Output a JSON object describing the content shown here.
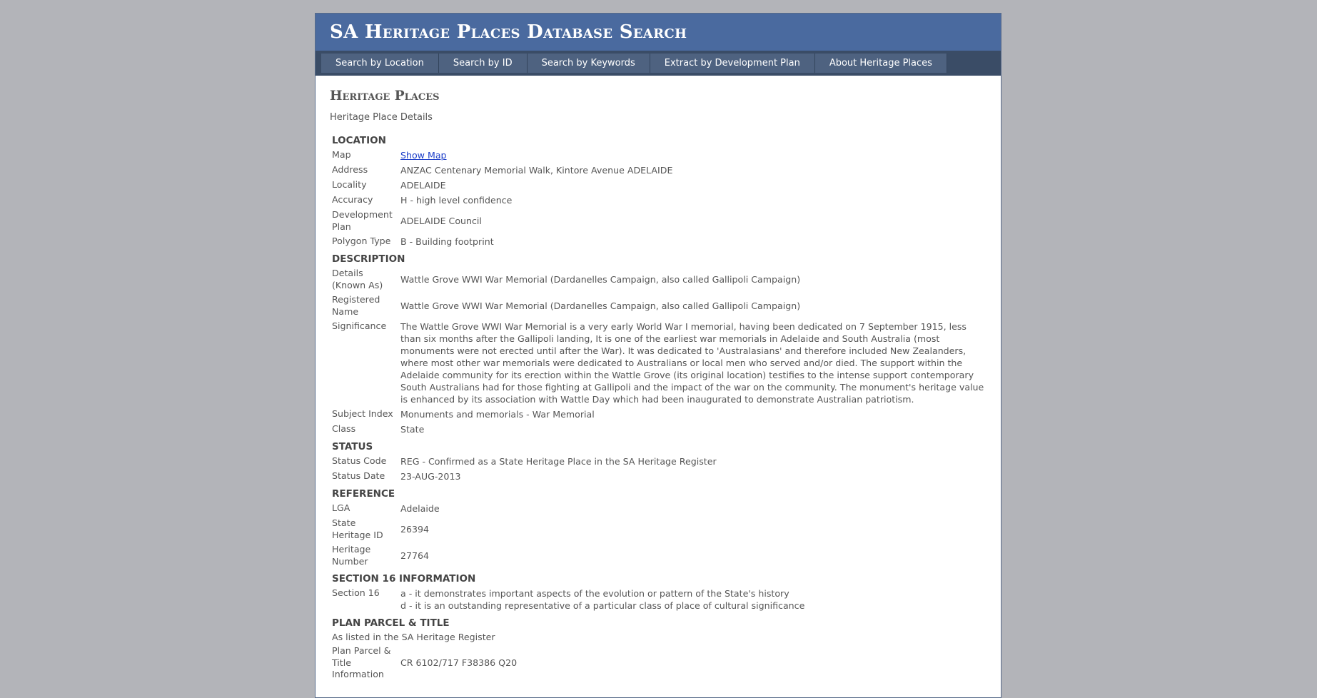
{
  "header": {
    "title": "SA Heritage Places Database Search"
  },
  "nav": [
    {
      "label": "Search by Location"
    },
    {
      "label": "Search by ID"
    },
    {
      "label": "Search by Keywords"
    },
    {
      "label": "Extract by Development Plan"
    },
    {
      "label": "About Heritage Places"
    }
  ],
  "page": {
    "heading": "Heritage Places",
    "subtitle": "Heritage Place Details"
  },
  "location": {
    "title": "LOCATION",
    "map_label": "Map",
    "map_link": "Show Map",
    "address_label": "Address",
    "address": "ANZAC Centenary Memorial Walk, Kintore Avenue ADELAIDE",
    "locality_label": "Locality",
    "locality": "ADELAIDE",
    "accuracy_label": "Accuracy",
    "accuracy": "H - high level confidence",
    "devplan_label": "Development Plan",
    "devplan": "ADELAIDE Council",
    "polygon_label": "Polygon Type",
    "polygon": "B - Building footprint"
  },
  "description": {
    "title": "DESCRIPTION",
    "known_as_label": "Details (Known As)",
    "known_as": "Wattle Grove WWI War Memorial (Dardanelles Campaign, also called Gallipoli Campaign)",
    "registered_label": "Registered Name",
    "registered": "Wattle Grove WWI War Memorial (Dardanelles Campaign, also called Gallipoli Campaign)",
    "significance_label": "Significance",
    "significance": "The Wattle Grove WWI War Memorial is a very early World War I memorial, having been dedicated on 7 September 1915, less than six months after the Gallipoli landing, It is one of the earliest war memorials in Adelaide and South Australia (most monuments were not erected until after the War). It was dedicated to 'Australasians' and therefore included New Zealanders, where most other war memorials were dedicated to Australians or local men who served and/or died. The support within the Adelaide community for its erection within the Wattle Grove (its original location) testifies to the intense support contemporary South Australians had for those fighting at Gallipoli and the impact of the war on the community. The monument's heritage value is enhanced by its association with Wattle Day which had been inaugurated to demonstrate Australian patriotism.",
    "subject_label": "Subject Index",
    "subject": "Monuments and memorials - War Memorial",
    "class_label": "Class",
    "class": "State"
  },
  "status": {
    "title": "STATUS",
    "code_label": "Status Code",
    "code": "REG - Confirmed as a State Heritage Place in the SA Heritage Register",
    "date_label": "Status Date",
    "date": "23-AUG-2013"
  },
  "reference": {
    "title": "REFERENCE",
    "lga_label": "LGA",
    "lga": "Adelaide",
    "state_id_label": "State Heritage ID",
    "state_id": "26394",
    "heritage_no_label": "Heritage Number",
    "heritage_no": "27764"
  },
  "section16": {
    "title": "SECTION 16 INFORMATION",
    "label": "Section 16",
    "criteria_a": "a - it demonstrates important aspects of the evolution or pattern of the State's history",
    "criteria_d": "d - it is an outstanding representative of a particular class of place of cultural significance"
  },
  "plan": {
    "title": "PLAN PARCEL & TITLE",
    "note": "As listed in the SA Heritage Register",
    "info_label": "Plan Parcel & Title Information",
    "info": "CR 6102/717 F38386 Q20"
  }
}
